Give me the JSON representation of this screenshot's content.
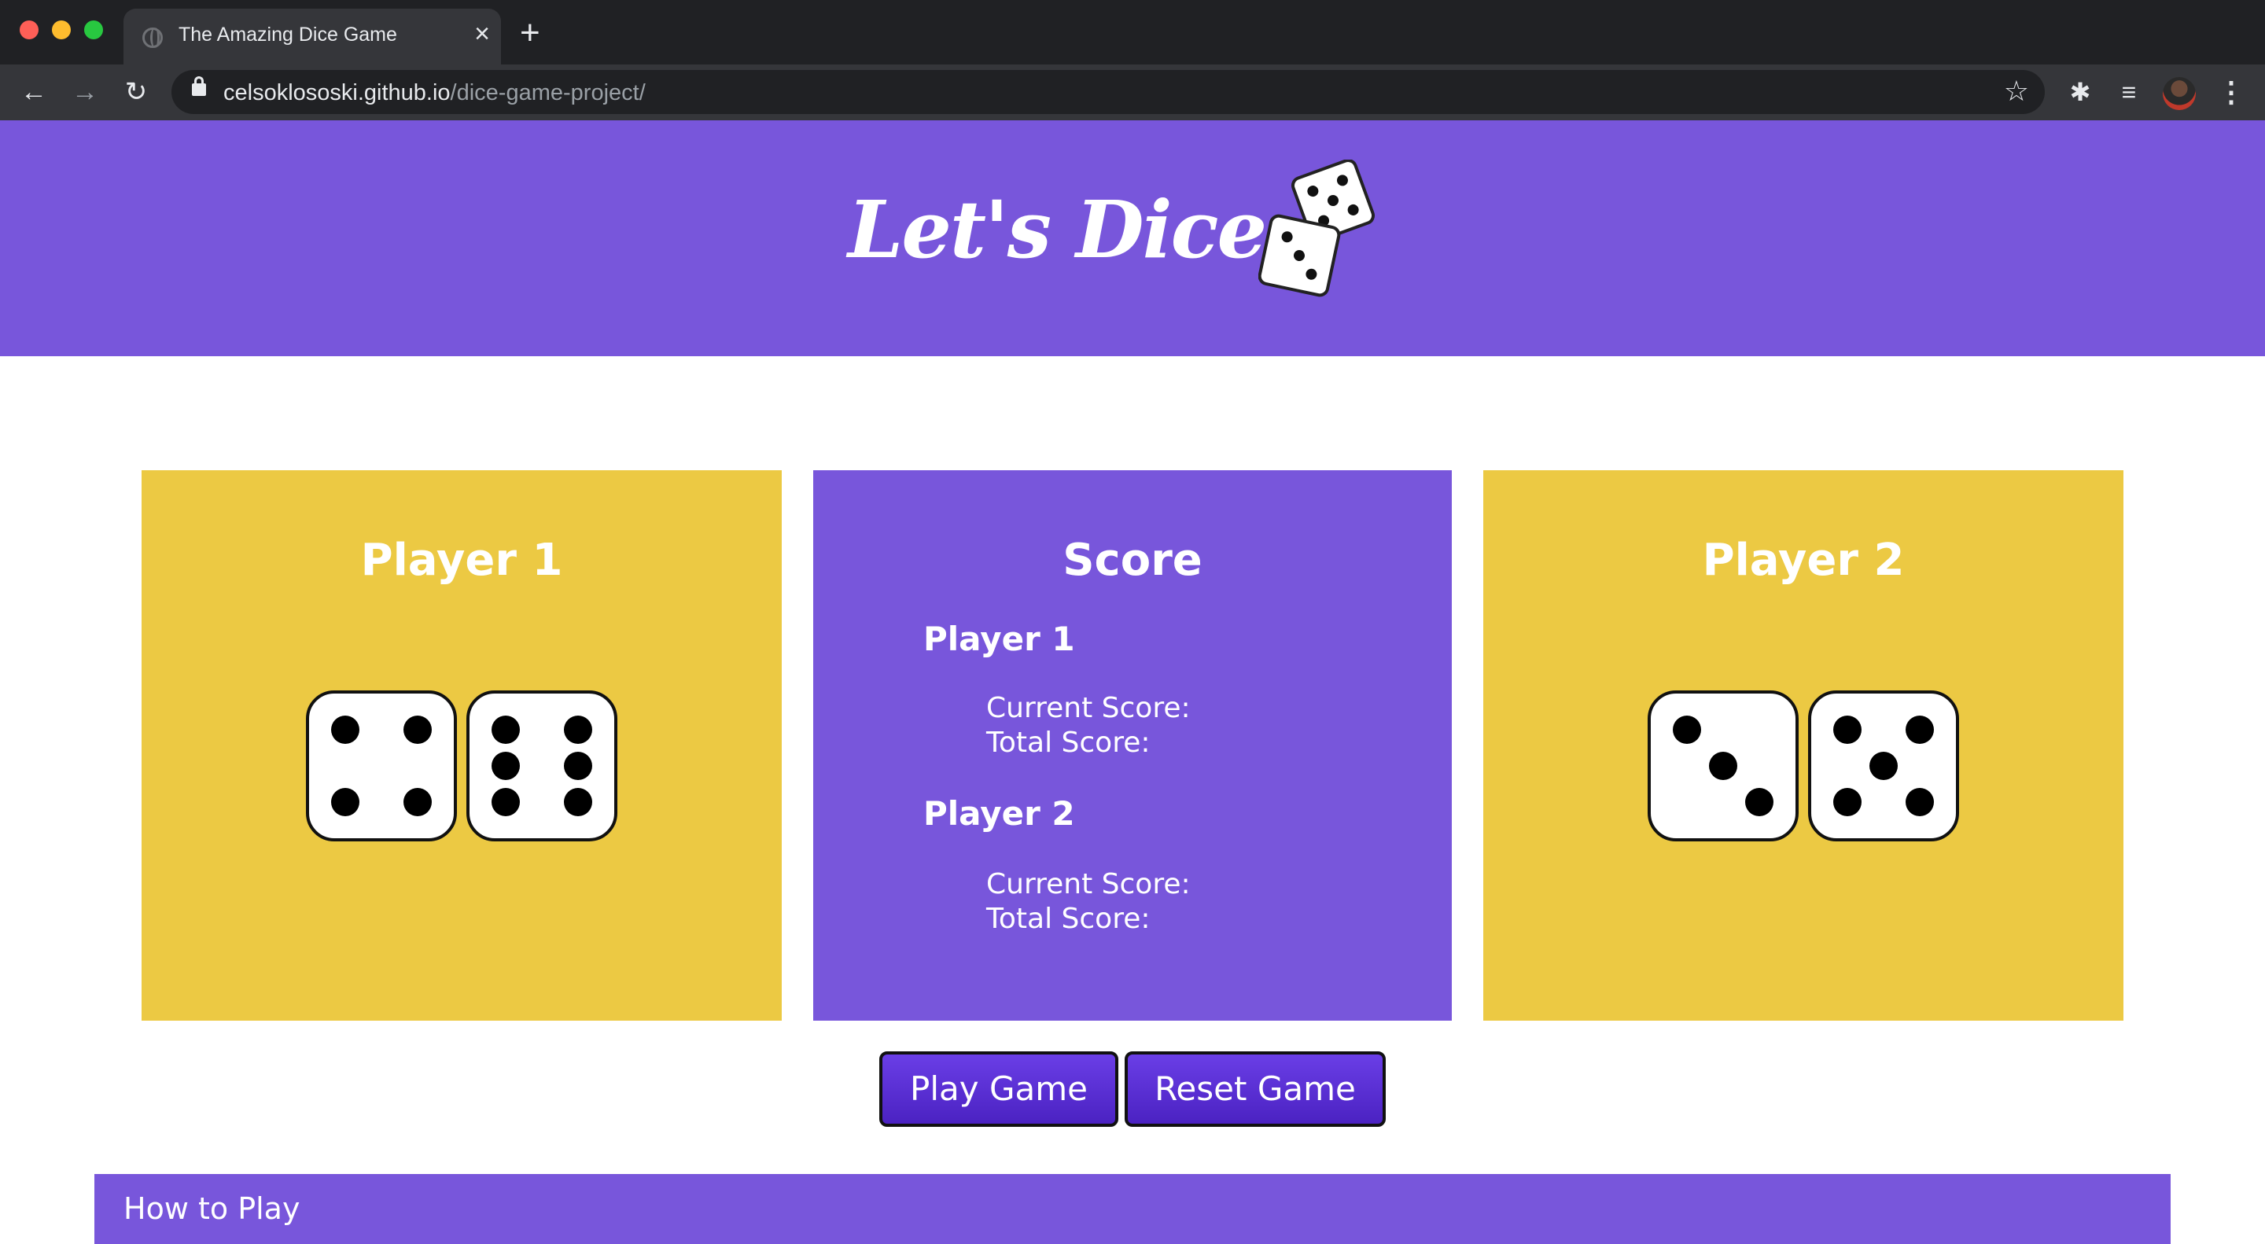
{
  "browser": {
    "tab_title": "The Amazing Dice Game",
    "url_host": "celsoklososki.github.io",
    "url_path": "/dice-game-project/"
  },
  "header": {
    "title": "Let's Dice !"
  },
  "colors": {
    "purple": "#7856db",
    "yellow": "#ecc943",
    "button": "#5a30d8"
  },
  "player1": {
    "title": "Player 1",
    "dice": [
      4,
      6
    ]
  },
  "player2": {
    "title": "Player 2",
    "dice": [
      3,
      5
    ]
  },
  "score": {
    "title": "Score",
    "player1_heading": "Player 1",
    "player1_current": "Current Score:",
    "player1_total": "Total Score:",
    "player2_heading": "Player 2",
    "player2_current": "Current Score:",
    "player2_total": "Total Score:"
  },
  "buttons": {
    "play": "Play Game",
    "reset": "Reset Game"
  },
  "howto": {
    "label": "How to Play"
  }
}
